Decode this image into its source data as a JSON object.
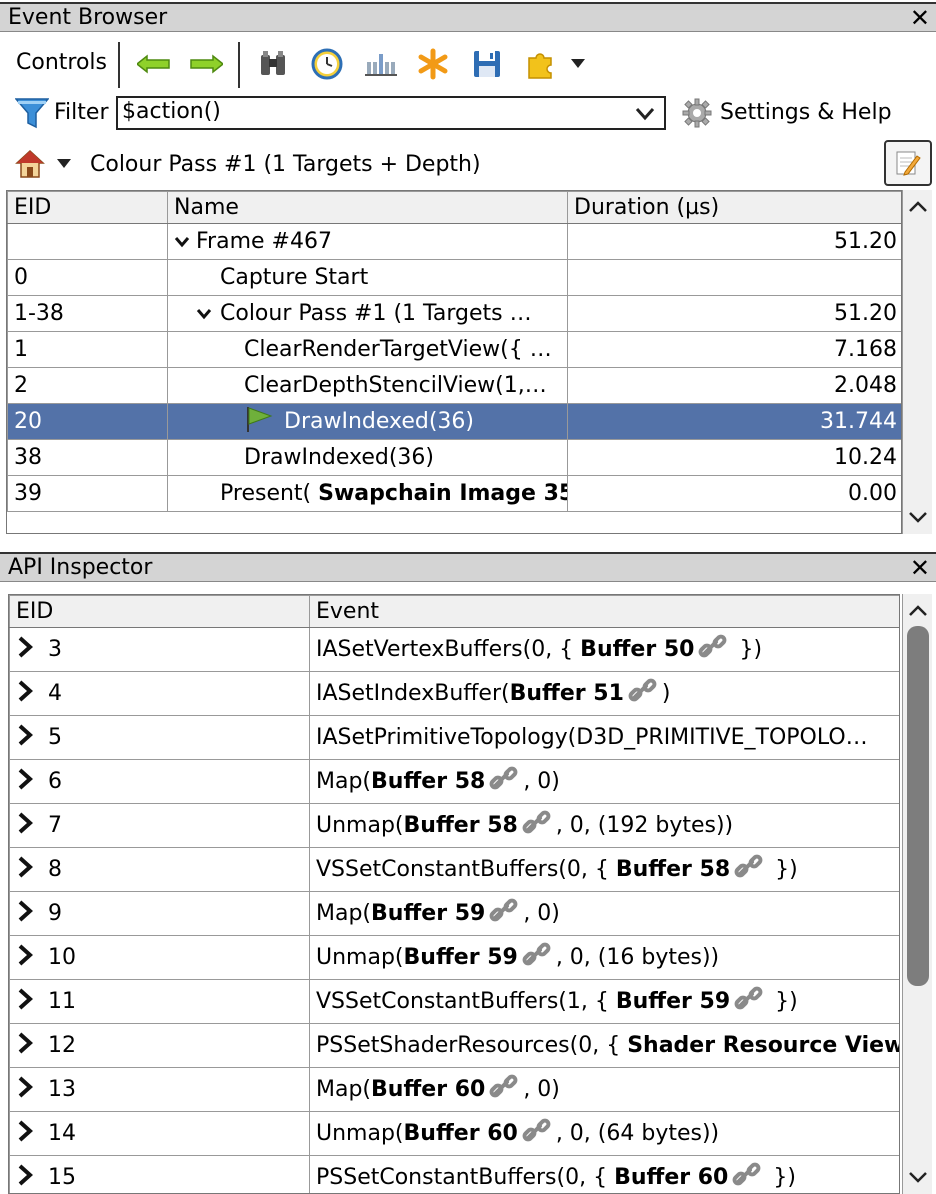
{
  "event_browser": {
    "title": "Event Browser",
    "controls_label": "Controls",
    "filter_label": "Filter",
    "filter_value": "$action()",
    "settings_label": "Settings & Help",
    "breadcrumb": "Colour Pass #1 (1 Targets + Depth)",
    "columns": [
      "EID",
      "Name",
      "Duration (µs)"
    ],
    "rows": [
      {
        "eid": "",
        "name": "Frame #467",
        "duration": "51.20"
      },
      {
        "eid": "0",
        "name": "Capture Start",
        "duration": ""
      },
      {
        "eid": "1-38",
        "name": "Colour Pass #1 (1 Targets …",
        "duration": "51.20"
      },
      {
        "eid": "1",
        "name": "ClearRenderTargetView({ …",
        "duration": "7.168"
      },
      {
        "eid": "2",
        "name": "ClearDepthStencilView(1,…",
        "duration": "2.048"
      },
      {
        "eid": "20",
        "name": "DrawIndexed(36)",
        "duration": "31.744"
      },
      {
        "eid": "38",
        "name": "DrawIndexed(36)",
        "duration": "10.24"
      },
      {
        "eid": "39",
        "name_prefix": "Present(",
        "name_bold": "Swapchain Image 35",
        "duration": "0.00"
      }
    ]
  },
  "api_inspector": {
    "title": "API Inspector",
    "columns": [
      "EID",
      "Event"
    ],
    "rows": [
      {
        "eid": "3",
        "pre": "IASetVertexBuffers(0, { ",
        "bold": "Buffer 50",
        "link": true,
        "post": " })"
      },
      {
        "eid": "4",
        "pre": "IASetIndexBuffer(",
        "bold": "Buffer 51",
        "link": true,
        "post": ")"
      },
      {
        "eid": "5",
        "pre": "IASetPrimitiveTopology(D3D_PRIMITIVE_TOPOLO…",
        "bold": "",
        "link": false,
        "post": ""
      },
      {
        "eid": "6",
        "pre": "Map(",
        "bold": "Buffer 58",
        "link": true,
        "post": ", 0)"
      },
      {
        "eid": "7",
        "pre": "Unmap(",
        "bold": "Buffer 58",
        "link": true,
        "post": ", 0, (192 bytes))"
      },
      {
        "eid": "8",
        "pre": "VSSetConstantBuffers(0, { ",
        "bold": "Buffer 58",
        "link": true,
        "post": " })"
      },
      {
        "eid": "9",
        "pre": "Map(",
        "bold": "Buffer 59",
        "link": true,
        "post": ", 0)"
      },
      {
        "eid": "10",
        "pre": "Unmap(",
        "bold": "Buffer 59",
        "link": true,
        "post": ", 0, (16 bytes))"
      },
      {
        "eid": "11",
        "pre": "VSSetConstantBuffers(1, { ",
        "bold": "Buffer 59",
        "link": true,
        "post": " })"
      },
      {
        "eid": "12",
        "pre": "PSSetShaderResources(0, { ",
        "bold": "Shader Resource View",
        "link": false,
        "post": ""
      },
      {
        "eid": "13",
        "pre": "Map(",
        "bold": "Buffer 60",
        "link": true,
        "post": ", 0)"
      },
      {
        "eid": "14",
        "pre": "Unmap(",
        "bold": "Buffer 60",
        "link": true,
        "post": ", 0, (64 bytes))"
      },
      {
        "eid": "15",
        "pre": "PSSetConstantBuffers(0, { ",
        "bold": "Buffer 60",
        "link": true,
        "post": " })"
      }
    ]
  },
  "colors": {
    "selection": "#5372a8",
    "title_bar": "#d4d4d4"
  }
}
